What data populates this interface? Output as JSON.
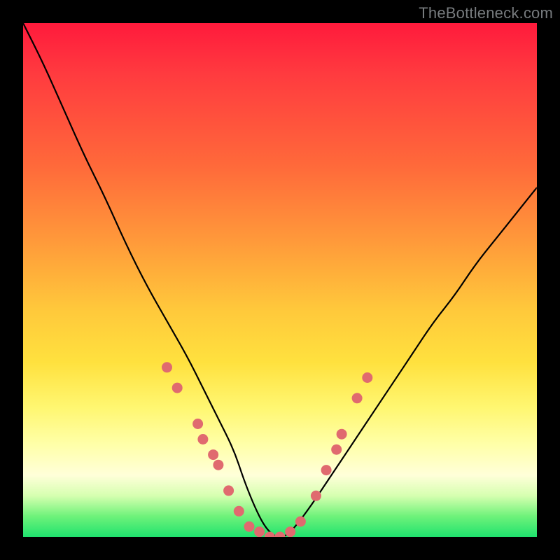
{
  "watermark": "TheBottleneck.com",
  "chart_data": {
    "type": "line",
    "title": "",
    "xlabel": "",
    "ylabel": "",
    "xlim": [
      0,
      100
    ],
    "ylim": [
      0,
      100
    ],
    "grid": false,
    "legend": false,
    "note": "Bottleneck-style V-curve on rainbow heat gradient; lower y = better (green).",
    "series": [
      {
        "name": "bottleneck-curve",
        "x": [
          0,
          4,
          8,
          12,
          16,
          20,
          24,
          28,
          32,
          35,
          38,
          41,
          43,
          45,
          47,
          49,
          51,
          53,
          56,
          60,
          64,
          68,
          72,
          76,
          80,
          84,
          88,
          92,
          96,
          100
        ],
        "y": [
          100,
          92,
          83,
          74,
          66,
          57,
          49,
          42,
          35,
          29,
          23,
          17,
          11,
          6,
          2,
          0,
          0,
          2,
          6,
          12,
          18,
          24,
          30,
          36,
          42,
          47,
          53,
          58,
          63,
          68
        ]
      }
    ],
    "marker_points": {
      "name": "highlight-dots",
      "color": "#e06a6f",
      "points": [
        {
          "x": 28,
          "y": 33
        },
        {
          "x": 30,
          "y": 29
        },
        {
          "x": 34,
          "y": 22
        },
        {
          "x": 35,
          "y": 19
        },
        {
          "x": 37,
          "y": 16
        },
        {
          "x": 38,
          "y": 14
        },
        {
          "x": 40,
          "y": 9
        },
        {
          "x": 42,
          "y": 5
        },
        {
          "x": 44,
          "y": 2
        },
        {
          "x": 46,
          "y": 1
        },
        {
          "x": 48,
          "y": 0
        },
        {
          "x": 50,
          "y": 0
        },
        {
          "x": 52,
          "y": 1
        },
        {
          "x": 54,
          "y": 3
        },
        {
          "x": 57,
          "y": 8
        },
        {
          "x": 59,
          "y": 13
        },
        {
          "x": 61,
          "y": 17
        },
        {
          "x": 62,
          "y": 20
        },
        {
          "x": 65,
          "y": 27
        },
        {
          "x": 67,
          "y": 31
        }
      ]
    },
    "gradient_stops": [
      {
        "pos": 0,
        "color": "#ff1a3c"
      },
      {
        "pos": 10,
        "color": "#ff3b3f"
      },
      {
        "pos": 28,
        "color": "#ff6a3a"
      },
      {
        "pos": 42,
        "color": "#ff983a"
      },
      {
        "pos": 56,
        "color": "#ffc93b"
      },
      {
        "pos": 66,
        "color": "#ffe13e"
      },
      {
        "pos": 75,
        "color": "#fff772"
      },
      {
        "pos": 82,
        "color": "#ffffa8"
      },
      {
        "pos": 88,
        "color": "#ffffd9"
      },
      {
        "pos": 92,
        "color": "#d6ffb0"
      },
      {
        "pos": 96,
        "color": "#6ef27a"
      },
      {
        "pos": 100,
        "color": "#1fe26e"
      }
    ]
  }
}
